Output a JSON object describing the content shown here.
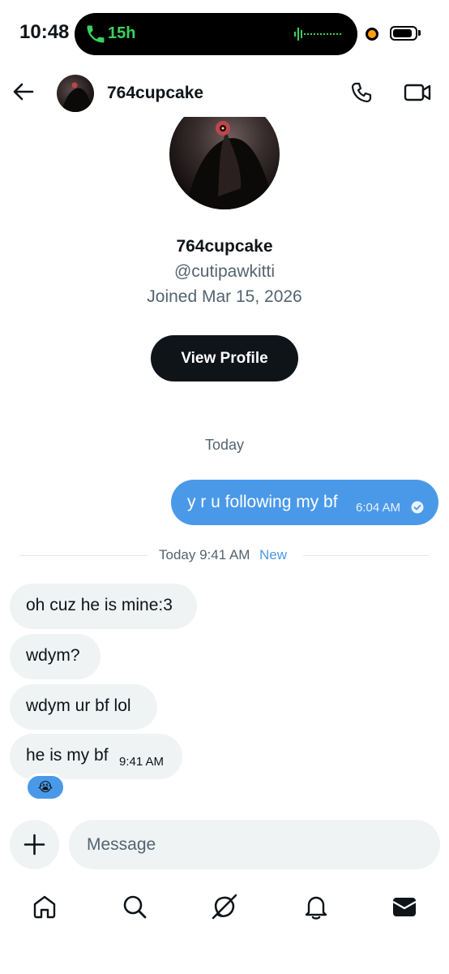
{
  "status_bar": {
    "time": "10:48",
    "call_duration": "15h",
    "battery_level": 0.9,
    "recording_indicator_color": "#ff9f0a",
    "call_color": "#3ad15f"
  },
  "header": {
    "back_icon": "arrow-left-icon",
    "name": "764cupcake",
    "call_icon": "phone-icon",
    "video_icon": "video-camera-icon"
  },
  "profile": {
    "name": "764cupcake",
    "handle": "@cutipawkitti",
    "joined": "Joined Mar 15, 2026",
    "view_profile_label": "View Profile"
  },
  "messages": {
    "day_label": "Today",
    "outgoing": {
      "text": "y r u following my bf",
      "time": "6:04 AM",
      "status_icon": "check-circle-icon"
    },
    "divider": {
      "label": "Today 9:41 AM",
      "new_label": "New"
    },
    "incoming": [
      {
        "text": "oh cuz he is mine:3"
      },
      {
        "text": "wdym?"
      },
      {
        "text": "wdym ur bf lol"
      },
      {
        "text": "he is my bf",
        "time": "9:41 AM",
        "reaction": "😭"
      }
    ]
  },
  "composer": {
    "add_icon": "plus-icon",
    "placeholder": "Message"
  },
  "nav": {
    "items": [
      {
        "icon": "home-icon"
      },
      {
        "icon": "search-icon"
      },
      {
        "icon": "grok-icon"
      },
      {
        "icon": "bell-icon"
      },
      {
        "icon": "mail-icon",
        "active": true
      }
    ]
  },
  "colors": {
    "accent": "#4a99e9",
    "bubble_in": "#eff3f4",
    "text_secondary": "#536471",
    "button_dark": "#0f1419"
  }
}
